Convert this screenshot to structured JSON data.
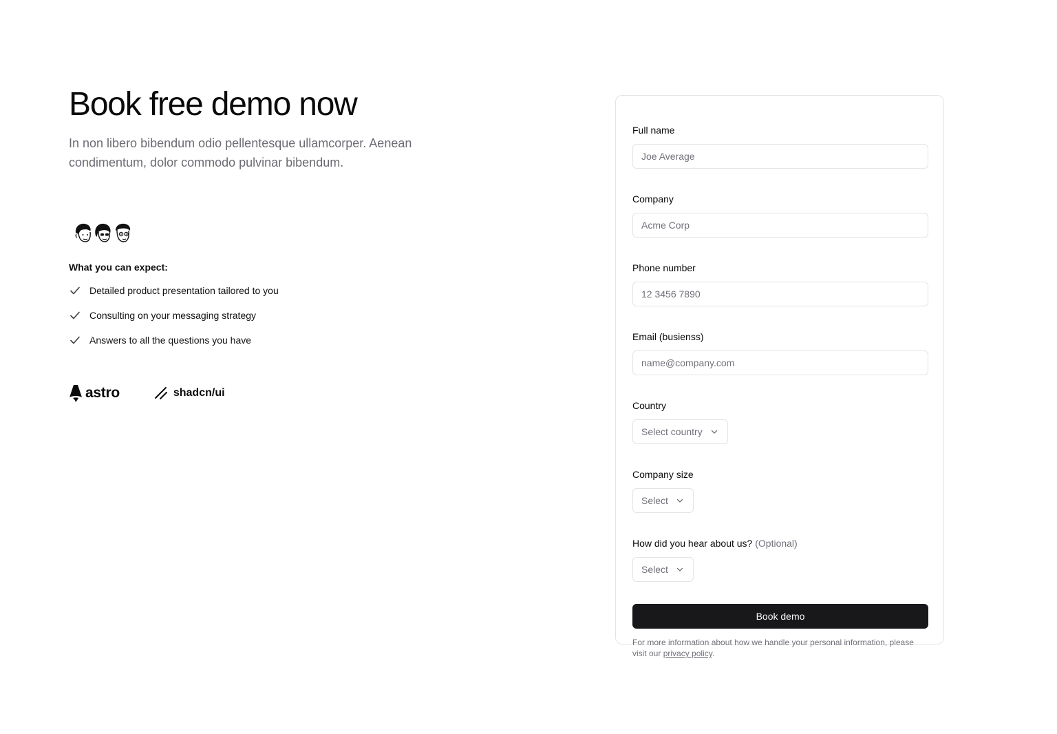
{
  "hero": {
    "title": "Book free demo now",
    "subtitle": "In non libero bibendum odio pellentesque ullamcorper. Aenean condimentum, dolor commodo pulvinar bibendum."
  },
  "expect": {
    "title": "What you can expect:",
    "items": [
      "Detailed product presentation tailored to you",
      "Consulting on your messaging strategy",
      "Answers to all the questions you have"
    ]
  },
  "logos": {
    "astro": "astro",
    "shadcn": "shadcn/ui"
  },
  "form": {
    "full_name": {
      "label": "Full name",
      "placeholder": "Joe Average"
    },
    "company": {
      "label": "Company",
      "placeholder": "Acme Corp"
    },
    "phone": {
      "label": "Phone number",
      "placeholder": "12 3456 7890"
    },
    "email": {
      "label": "Email (busienss)",
      "placeholder": "name@company.com"
    },
    "country": {
      "label": "Country",
      "value": "Select country"
    },
    "company_size": {
      "label": "Company size",
      "value": "Select"
    },
    "hear": {
      "label": "How did you hear about us?",
      "optional": "(Optional)",
      "value": "Select"
    },
    "submit_label": "Book demo",
    "disclaimer_text": "For more information about how we handle your personal information, please visit our",
    "privacy_link": "privacy policy",
    "disclaimer_end": "."
  },
  "colors": {
    "primary": "#18181b",
    "muted_text": "#71717a",
    "border": "#e4e4e7"
  }
}
